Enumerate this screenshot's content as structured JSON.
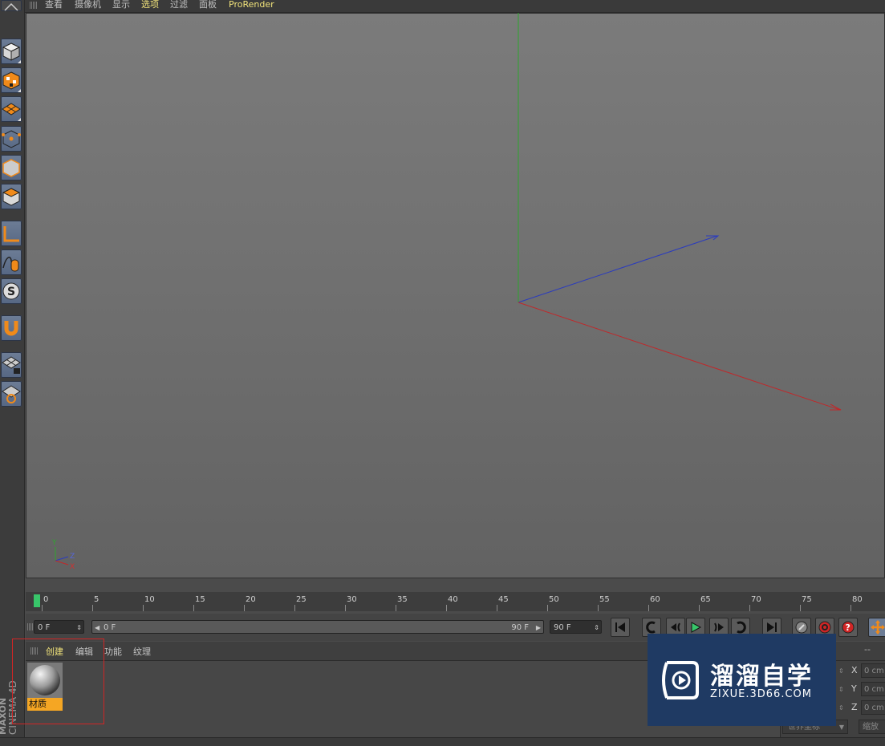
{
  "menu": {
    "items": [
      {
        "label": "查看",
        "active": false
      },
      {
        "label": "摄像机",
        "active": false
      },
      {
        "label": "显示",
        "active": false
      },
      {
        "label": "选项",
        "active": true
      },
      {
        "label": "过滤",
        "active": false
      },
      {
        "label": "面板",
        "active": false
      },
      {
        "label": "ProRender",
        "active": true
      }
    ]
  },
  "toolbar": {
    "icons": [
      "cube-icon",
      "checker-cube-icon",
      "plane-grid-icon",
      "polygon-points-icon",
      "edges-cube-icon",
      "faces-cube-icon",
      "axis-icon",
      "mouse-spline-icon",
      "snap-s-icon",
      "magnet-icon",
      "grid-lock-icon",
      "workplane-icon"
    ]
  },
  "viewport": {
    "axis_gizmo": {
      "y": "Y",
      "z": "Z",
      "x": "X"
    }
  },
  "timeline": {
    "ticks": [
      "0",
      "5",
      "10",
      "15",
      "20",
      "25",
      "30",
      "35",
      "40",
      "45",
      "50",
      "55",
      "60",
      "65",
      "70",
      "75",
      "80"
    ]
  },
  "controls": {
    "current_frame": "0 F",
    "range_start": "0 F",
    "range_end": "90 F",
    "end_frame": "90 F"
  },
  "material_manager": {
    "menu": [
      {
        "label": "创建",
        "active": true
      },
      {
        "label": "编辑",
        "active": false
      },
      {
        "label": "功能",
        "active": false
      },
      {
        "label": "纹理",
        "active": false
      }
    ],
    "material": {
      "name": "材质"
    }
  },
  "brand": {
    "maxon": "MAXON",
    "cinema": "CINEMA 4D"
  },
  "coordinates": {
    "header_dash": "--",
    "rows": [
      {
        "axis": "X",
        "value": "0 cm"
      },
      {
        "axis": "Y",
        "value": "0 cm"
      },
      {
        "axis": "Z",
        "value": "0 cm"
      }
    ],
    "mode_label": "世界坐标",
    "scale_label": "缩放"
  },
  "watermark": {
    "title": "溜溜自学",
    "url": "ZIXUE.3D66.COM"
  },
  "colors": {
    "accent": "#f0e27a",
    "material_label_bg": "#f5a623",
    "x_axis": "#c0282a",
    "y_axis": "#2ea52e",
    "z_axis": "#2a3bbf",
    "play_green": "#38c66a",
    "highlight_red": "#d02525"
  }
}
